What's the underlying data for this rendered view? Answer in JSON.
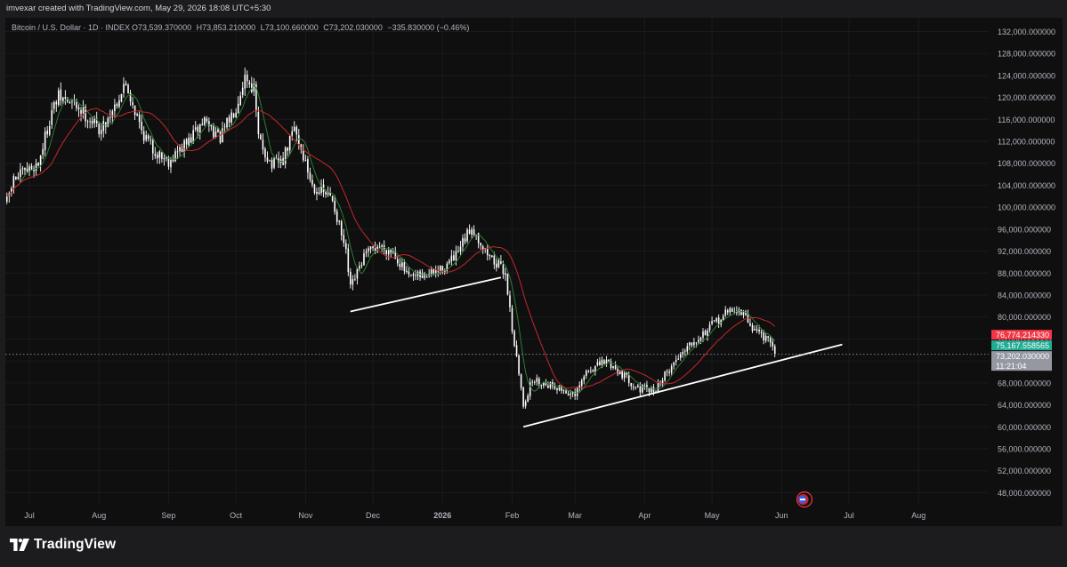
{
  "header": {
    "attribution": "imvexar created with TradingView.com, May 29, 2026 18:08 UTC+5:30"
  },
  "footer": {
    "brand": "TradingView"
  },
  "colors": {
    "background": "#0f0f10",
    "candle": "#ffffff",
    "ma_fast": "#2e7d32",
    "ma_slow": "#c62828",
    "trendline": "#ffffff",
    "tag_red": "#f23645",
    "tag_green": "#22ab94",
    "tag_gray": "#9598a1"
  },
  "chart_data": {
    "type": "candlestick",
    "legend": {
      "symbol": "Bitcoin / U.S. Dollar · 1D · INDEX",
      "open_label": "O",
      "open": "73,539.370000",
      "high_label": "H",
      "high": "73,853.210000",
      "low_label": "L",
      "low": "73,100.660000",
      "close_label": "C",
      "close": "73,202.030000",
      "change": "−335.830000 (−0.46%)"
    },
    "x_labels": [
      "Jul",
      "Aug",
      "Sep",
      "Oct",
      "Nov",
      "Dec",
      "2026",
      "Feb",
      "Mar",
      "Apr",
      "May",
      "Jun",
      "Jul",
      "Aug"
    ],
    "x_label_days": [
      0,
      31,
      62,
      92,
      123,
      153,
      184,
      215,
      243,
      274,
      304,
      335,
      365,
      396
    ],
    "y_ticks": [
      48000,
      52000,
      56000,
      60000,
      64000,
      68000,
      72000,
      76000,
      80000,
      84000,
      88000,
      92000,
      96000,
      100000,
      104000,
      108000,
      112000,
      116000,
      120000,
      124000,
      128000,
      132000
    ],
    "y_tick_labels": [
      "48,000.000000",
      "52,000.000000",
      "56,000.000000",
      "60,000.000000",
      "64,000.000000",
      "68,000.000000",
      "72,000.000000",
      "76,000.000000",
      "80,000.000000",
      "84,000.000000",
      "88,000.000000",
      "92,000.000000",
      "96,000.000000",
      "100,000.000000",
      "104,000.000000",
      "108,000.000000",
      "112,000.000000",
      "116,000.000000",
      "120,000.000000",
      "124,000.000000",
      "128,000.000000",
      "132,000.000000"
    ],
    "ylim": [
      45800,
      134500
    ],
    "price_path": [
      {
        "date": "2025-06-21",
        "price": 101000
      },
      {
        "date": "2025-06-24",
        "price": 105000
      },
      {
        "date": "2025-07-05",
        "price": 108000
      },
      {
        "date": "2025-07-11",
        "price": 117500
      },
      {
        "date": "2025-07-14",
        "price": 120000
      },
      {
        "date": "2025-07-22",
        "price": 118500
      },
      {
        "date": "2025-08-02",
        "price": 114000
      },
      {
        "date": "2025-08-13",
        "price": 122500
      },
      {
        "date": "2025-08-20",
        "price": 114000
      },
      {
        "date": "2025-08-25",
        "price": 110500
      },
      {
        "date": "2025-09-01",
        "price": 108500
      },
      {
        "date": "2025-09-10",
        "price": 112000
      },
      {
        "date": "2025-09-17",
        "price": 116000
      },
      {
        "date": "2025-09-24",
        "price": 112500
      },
      {
        "date": "2025-10-01",
        "price": 118500
      },
      {
        "date": "2025-10-05",
        "price": 124000
      },
      {
        "date": "2025-10-09",
        "price": 121500
      },
      {
        "date": "2025-10-11",
        "price": 112500
      },
      {
        "date": "2025-10-17",
        "price": 107500
      },
      {
        "date": "2025-10-22",
        "price": 108500
      },
      {
        "date": "2025-10-27",
        "price": 114500
      },
      {
        "date": "2025-11-04",
        "price": 104000
      },
      {
        "date": "2025-11-13",
        "price": 101500
      },
      {
        "date": "2025-11-19",
        "price": 91500
      },
      {
        "date": "2025-11-21",
        "price": 85000
      },
      {
        "date": "2025-11-27",
        "price": 91000
      },
      {
        "date": "2025-12-03",
        "price": 93000
      },
      {
        "date": "2025-12-10",
        "price": 92000
      },
      {
        "date": "2025-12-17",
        "price": 87000
      },
      {
        "date": "2025-12-24",
        "price": 87500
      },
      {
        "date": "2025-12-31",
        "price": 88500
      },
      {
        "date": "2026-01-07",
        "price": 91000
      },
      {
        "date": "2026-01-14",
        "price": 96500
      },
      {
        "date": "2026-01-20",
        "price": 92000
      },
      {
        "date": "2026-01-29",
        "price": 88000
      },
      {
        "date": "2026-02-01",
        "price": 78000
      },
      {
        "date": "2026-02-06",
        "price": 64000
      },
      {
        "date": "2026-02-10",
        "price": 68500
      },
      {
        "date": "2026-02-20",
        "price": 67500
      },
      {
        "date": "2026-03-01",
        "price": 65500
      },
      {
        "date": "2026-03-06",
        "price": 70000
      },
      {
        "date": "2026-03-15",
        "price": 72000
      },
      {
        "date": "2026-03-21",
        "price": 70000
      },
      {
        "date": "2026-03-29",
        "price": 67000
      },
      {
        "date": "2026-04-05",
        "price": 66500
      },
      {
        "date": "2026-04-12",
        "price": 70500
      },
      {
        "date": "2026-04-20",
        "price": 75000
      },
      {
        "date": "2026-04-27",
        "price": 77000
      },
      {
        "date": "2026-05-04",
        "price": 79500
      },
      {
        "date": "2026-05-10",
        "price": 81500
      },
      {
        "date": "2026-05-15",
        "price": 80500
      },
      {
        "date": "2026-05-19",
        "price": 78000
      },
      {
        "date": "2026-05-23",
        "price": 77000
      },
      {
        "date": "2026-05-26",
        "price": 75500
      },
      {
        "date": "2026-05-29",
        "price": 73202
      }
    ],
    "trendlines": [
      {
        "start": {
          "date": "2025-11-21",
          "price": 81000
        },
        "end": {
          "date": "2026-01-27",
          "price": 87200
        }
      },
      {
        "start": {
          "date": "2026-02-06",
          "price": 60000
        },
        "end": {
          "date": "2026-06-28",
          "price": 75000
        }
      }
    ],
    "moving_averages": [
      {
        "color": "#2e7d32",
        "period": 7
      },
      {
        "color": "#c62828",
        "period": 21
      }
    ],
    "price_tags": [
      {
        "value": 76774.21433,
        "label": "76,774.214330",
        "color": "#f23645"
      },
      {
        "value": 75167.558565,
        "label": "75,167.558565",
        "color": "#22ab94"
      },
      {
        "value": 73202.03,
        "label": "73,202.030000",
        "color": "#9598a1",
        "sublabel": "11:21:04"
      }
    ],
    "last_price_line": 73202.03
  }
}
